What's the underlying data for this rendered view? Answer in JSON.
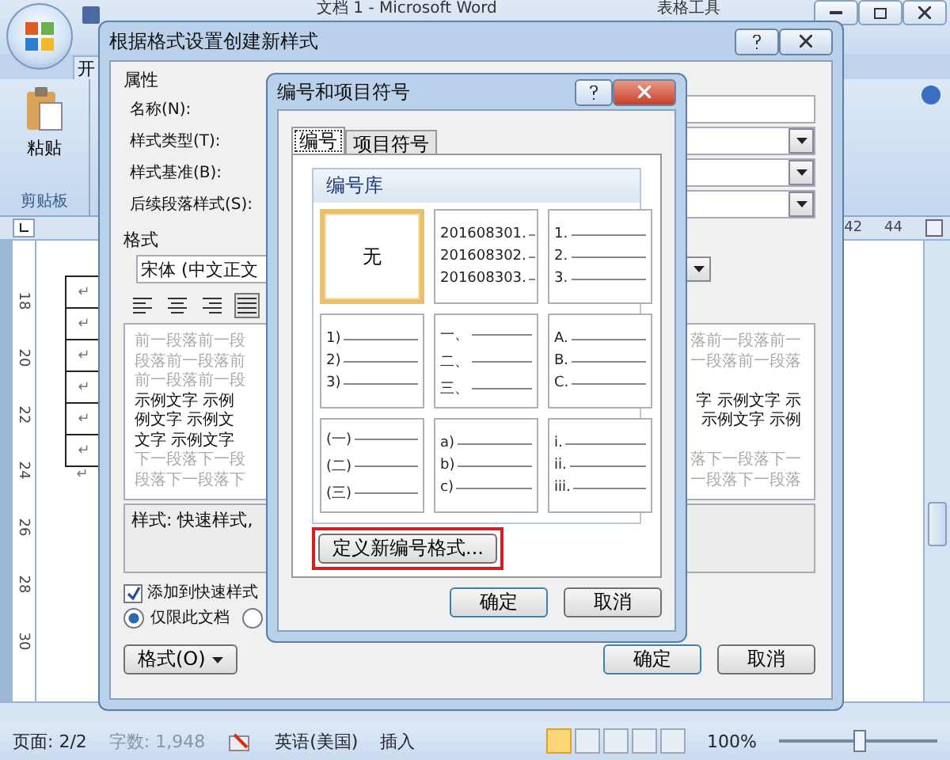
{
  "word": {
    "title": "文档 1 - Microsoft Word",
    "context_tab": "表格工具",
    "tab": "开",
    "paste_label": "粘贴",
    "clipboard_group": "剪贴板",
    "ruler_marks": [
      "42",
      "44"
    ],
    "vertical_ruler_marks": [
      "18",
      "20",
      "22",
      "24",
      "26",
      "28",
      "30"
    ],
    "table_marks": [
      "↵",
      "↵",
      "↵",
      "↵",
      "↵",
      "↵"
    ],
    "after_table_mark": "↵",
    "status_bar": {
      "page": "页面: 2/2",
      "words": "字数: 1,948",
      "language": "英语(美国)",
      "mode": "插入",
      "zoom": "100%",
      "zoom_slider": {
        "level": 0.5
      }
    }
  },
  "style_dialog": {
    "title": "根据格式设置创建新样式",
    "properties_heading": "属性",
    "fields": [
      {
        "label": "名称(N):",
        "kind": "text"
      },
      {
        "label": "样式类型(T):",
        "kind": "select"
      },
      {
        "label": "样式基准(B):",
        "kind": "select"
      },
      {
        "label": "后续段落样式(S):",
        "kind": "select"
      }
    ],
    "format_heading": "格式",
    "font": "宋体 (中文正文",
    "alignments": [
      {
        "selected": false
      },
      {
        "selected": false
      },
      {
        "selected": false
      },
      {
        "selected": true
      }
    ],
    "preview_rows": [
      {
        "kind": "before",
        "left": "前一段落前一段",
        "right": "落前一段落前一"
      },
      {
        "kind": "before",
        "left": "段落前一段落前",
        "right": "一段落前一段落"
      },
      {
        "kind": "before",
        "left": "前一段落前一段"
      },
      {
        "kind": "sample",
        "left": "示例文字 示例",
        "right": "字 示例文字 示"
      },
      {
        "kind": "sample",
        "left": "例文字 示例文",
        "right": "示例文字 示例"
      },
      {
        "kind": "sample",
        "left": "文字 示例文字"
      },
      {
        "kind": "after",
        "left": "下一段落下一段",
        "right": "落下一段落下一"
      },
      {
        "kind": "after",
        "left": "段落下一段落下",
        "right": "一段落下一段落"
      }
    ],
    "description": "样式: 快速样式,",
    "add_to_quick": {
      "label": "添加到快速样式",
      "checked": true
    },
    "scope": [
      {
        "label": "仅限此文档",
        "selected": true
      },
      {
        "selected": false
      }
    ],
    "format_button": "格式(O)",
    "ok": "确定",
    "cancel": "取消"
  },
  "numbering_dialog": {
    "title": "编号和项目符号",
    "tabs": [
      {
        "label": "编号",
        "selected": true
      },
      {
        "label": "项目符号",
        "selected": false
      }
    ],
    "library_heading": "编号库",
    "items": [
      {
        "kind": "none",
        "text": "无",
        "selected": true
      },
      {
        "kind": "list",
        "markers": [
          "201608301.",
          "201608302.",
          "201608303."
        ],
        "selected": false
      },
      {
        "kind": "list",
        "markers": [
          "1.",
          "2.",
          "3."
        ],
        "selected": false
      },
      {
        "kind": "list",
        "markers": [
          "1)",
          "2)",
          "3)"
        ],
        "selected": false
      },
      {
        "kind": "list",
        "markers": [
          "一、",
          "二、",
          "三、"
        ],
        "selected": false
      },
      {
        "kind": "list",
        "markers": [
          "A.",
          "B.",
          "C."
        ],
        "selected": false
      },
      {
        "kind": "list",
        "markers": [
          "(一)",
          "(二)",
          "(三)"
        ],
        "selected": false
      },
      {
        "kind": "list",
        "markers": [
          "a)",
          "b)",
          "c)"
        ],
        "selected": false
      },
      {
        "kind": "list",
        "markers": [
          "i.",
          "ii.",
          "iii."
        ],
        "selected": false
      }
    ],
    "define_button": {
      "label": "定义新编号格式...",
      "highlighted": true
    },
    "ok": "确定",
    "cancel": "取消"
  }
}
